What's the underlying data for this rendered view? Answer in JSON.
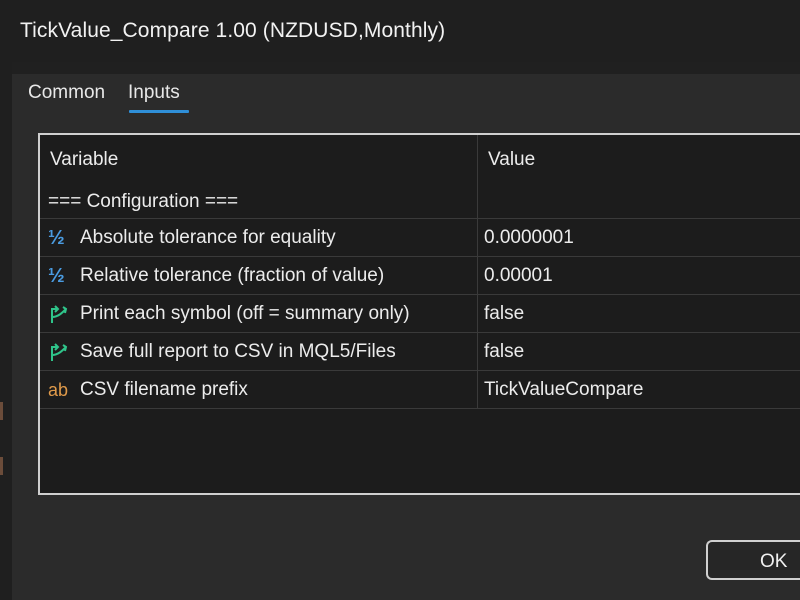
{
  "window": {
    "title": "TickValue_Compare 1.00 (NZDUSD,Monthly)"
  },
  "tabs": [
    {
      "label": "Common",
      "active": false
    },
    {
      "label": "Inputs",
      "active": true
    }
  ],
  "grid": {
    "columns": [
      "Variable",
      "Value"
    ],
    "section": "=== Configuration ===",
    "rows": [
      {
        "icon": "fraction-half-icon",
        "variable": "Absolute tolerance for equality",
        "value": "0.0000001"
      },
      {
        "icon": "fraction-half-icon",
        "variable": "Relative tolerance (fraction of value)",
        "value": "0.00001"
      },
      {
        "icon": "bool-arrow-icon",
        "variable": "Print each symbol (off = summary only)",
        "value": "false"
      },
      {
        "icon": "bool-arrow-icon",
        "variable": "Save full report to CSV in MQL5/Files",
        "value": "false"
      },
      {
        "icon": "string-ab-icon",
        "variable": "CSV filename prefix",
        "value": "TickValueCompare"
      }
    ]
  },
  "buttons": {
    "ok_label": "OK"
  },
  "icon_glyphs": {
    "fraction": "½",
    "string": "ab"
  },
  "colors": {
    "accent": "#2f8fd8",
    "numeric_icon": "#4a9be0",
    "bool_icon": "#2fc48a",
    "string_icon": "#e09a4a"
  }
}
